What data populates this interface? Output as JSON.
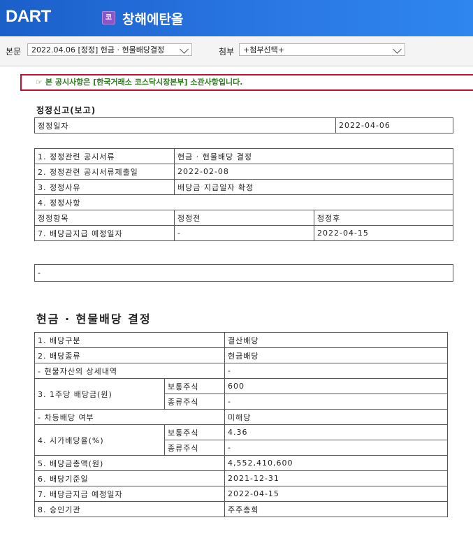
{
  "header": {
    "logo_text": "DART",
    "badge": "코",
    "company": "창해에탄올"
  },
  "toolbar": {
    "body_label": "본문",
    "body_select": "2022.04.06  [정정] 현금 · 현물배당결정",
    "attach_label": "첨부",
    "attach_select": "+첨부선택+"
  },
  "notice": {
    "icon": "pointing-hand-icon",
    "text": "본 공시사항은 [한국거래소 코스닥시장본부] 소관사항입니다."
  },
  "correction": {
    "title": "정정신고(보고)",
    "date_label": "정정일자",
    "date_value": "2022-04-06",
    "rows": [
      {
        "label": "1. 정정관련 공시서류",
        "value": "현금 · 현물배당 결정"
      },
      {
        "label": "2. 정정관련 공시서류제출일",
        "value": "2022-02-08"
      },
      {
        "label": "3. 정정사유",
        "value": "배당금 지급일자 확정"
      }
    ],
    "section4": "4. 정정사항",
    "headers": [
      "정정항목",
      "정정전",
      "정정후"
    ],
    "item": {
      "label": "7. 배당금지급 예정일자",
      "before": "-",
      "after": "2022-04-15"
    },
    "note": "-"
  },
  "dividend": {
    "title": "현금 · 현물배당 결정",
    "type_label": "1. 배당구분",
    "type_value": "결산배당",
    "kind_label": "2. 배당종류",
    "kind_value": "현금배당",
    "asset_label": "- 현물자산의 상세내역",
    "asset_value": "-",
    "dps_label": "3. 1주당 배당금(원)",
    "common_label": "보통주식",
    "preferred_label": "종류주식",
    "dps_common": "600",
    "dps_preferred": "-",
    "diff_label": "- 차등배당 여부",
    "diff_value": "미해당",
    "yield_label": "4. 시가배당율(%)",
    "yield_common": "4.36",
    "yield_preferred": "-",
    "total_label": "5. 배당금총액(원)",
    "total_value": "4,552,410,600",
    "record_label": "6. 배당기준일",
    "record_value": "2021-12-31",
    "pay_label": "7. 배당금지급 예정일자",
    "pay_value": "2022-04-15",
    "approval_label": "8. 승인기관",
    "approval_value": "주주총회"
  }
}
